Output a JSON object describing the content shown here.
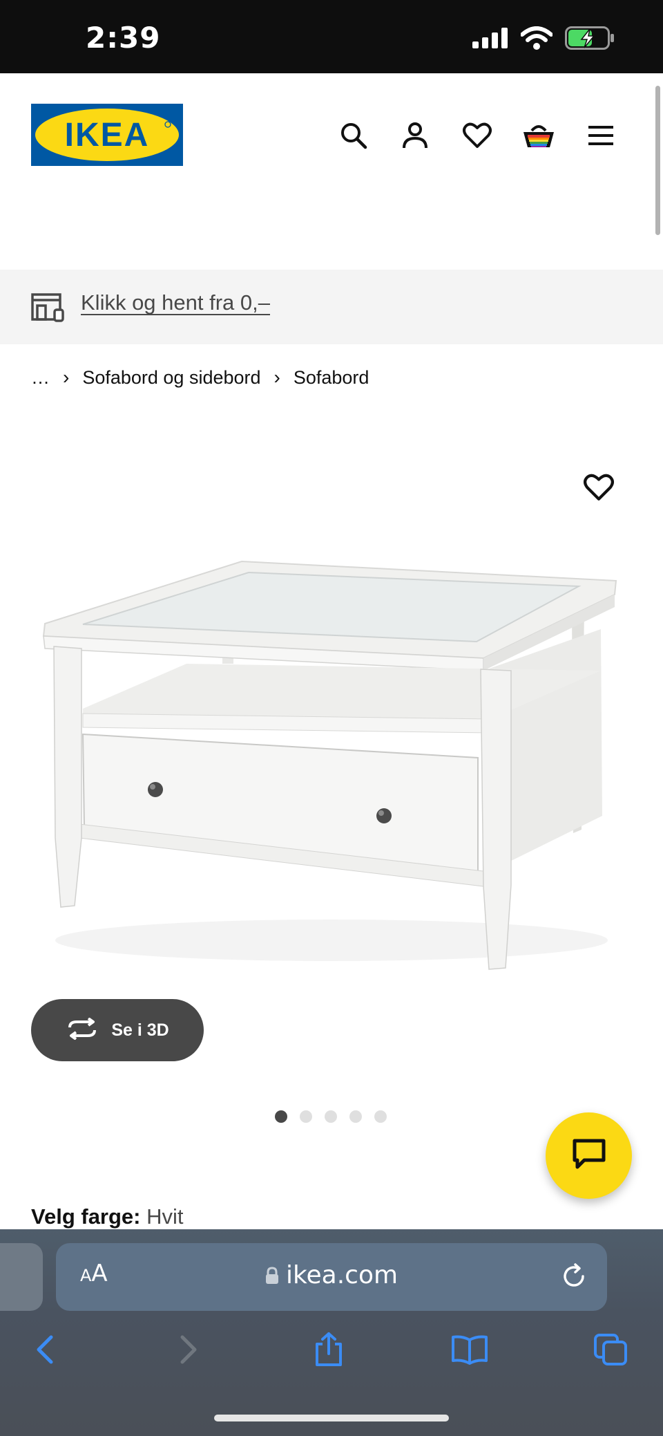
{
  "status_bar": {
    "time": "2:39",
    "icons": [
      "signal-icon",
      "wifi-icon",
      "battery-charging-icon"
    ]
  },
  "header": {
    "logo_text": "IKEA",
    "icons": [
      "search-icon",
      "account-icon",
      "heart-icon",
      "basket-icon",
      "menu-icon"
    ]
  },
  "banner": {
    "link_text": "Klikk og hent fra 0,–",
    "icon": "store-pickup-icon"
  },
  "breadcrumb": {
    "items": [
      "…",
      "Sofabord og sidebord",
      "Sofabord"
    ]
  },
  "product": {
    "view_3d_label": "Se i 3D",
    "image_count": 5,
    "active_image": 1,
    "color_label": "Velg farge:",
    "color_value": "Hvit"
  },
  "browser": {
    "aa_small": "A",
    "aa_big": "A",
    "url": "ikea.com",
    "toolbar": [
      "back-icon",
      "forward-icon",
      "share-icon",
      "bookmarks-icon",
      "tabs-icon"
    ]
  },
  "colors": {
    "ikea_blue": "#0058a3",
    "ikea_yellow": "#fbd914",
    "chat_yellow": "#fbd914"
  }
}
